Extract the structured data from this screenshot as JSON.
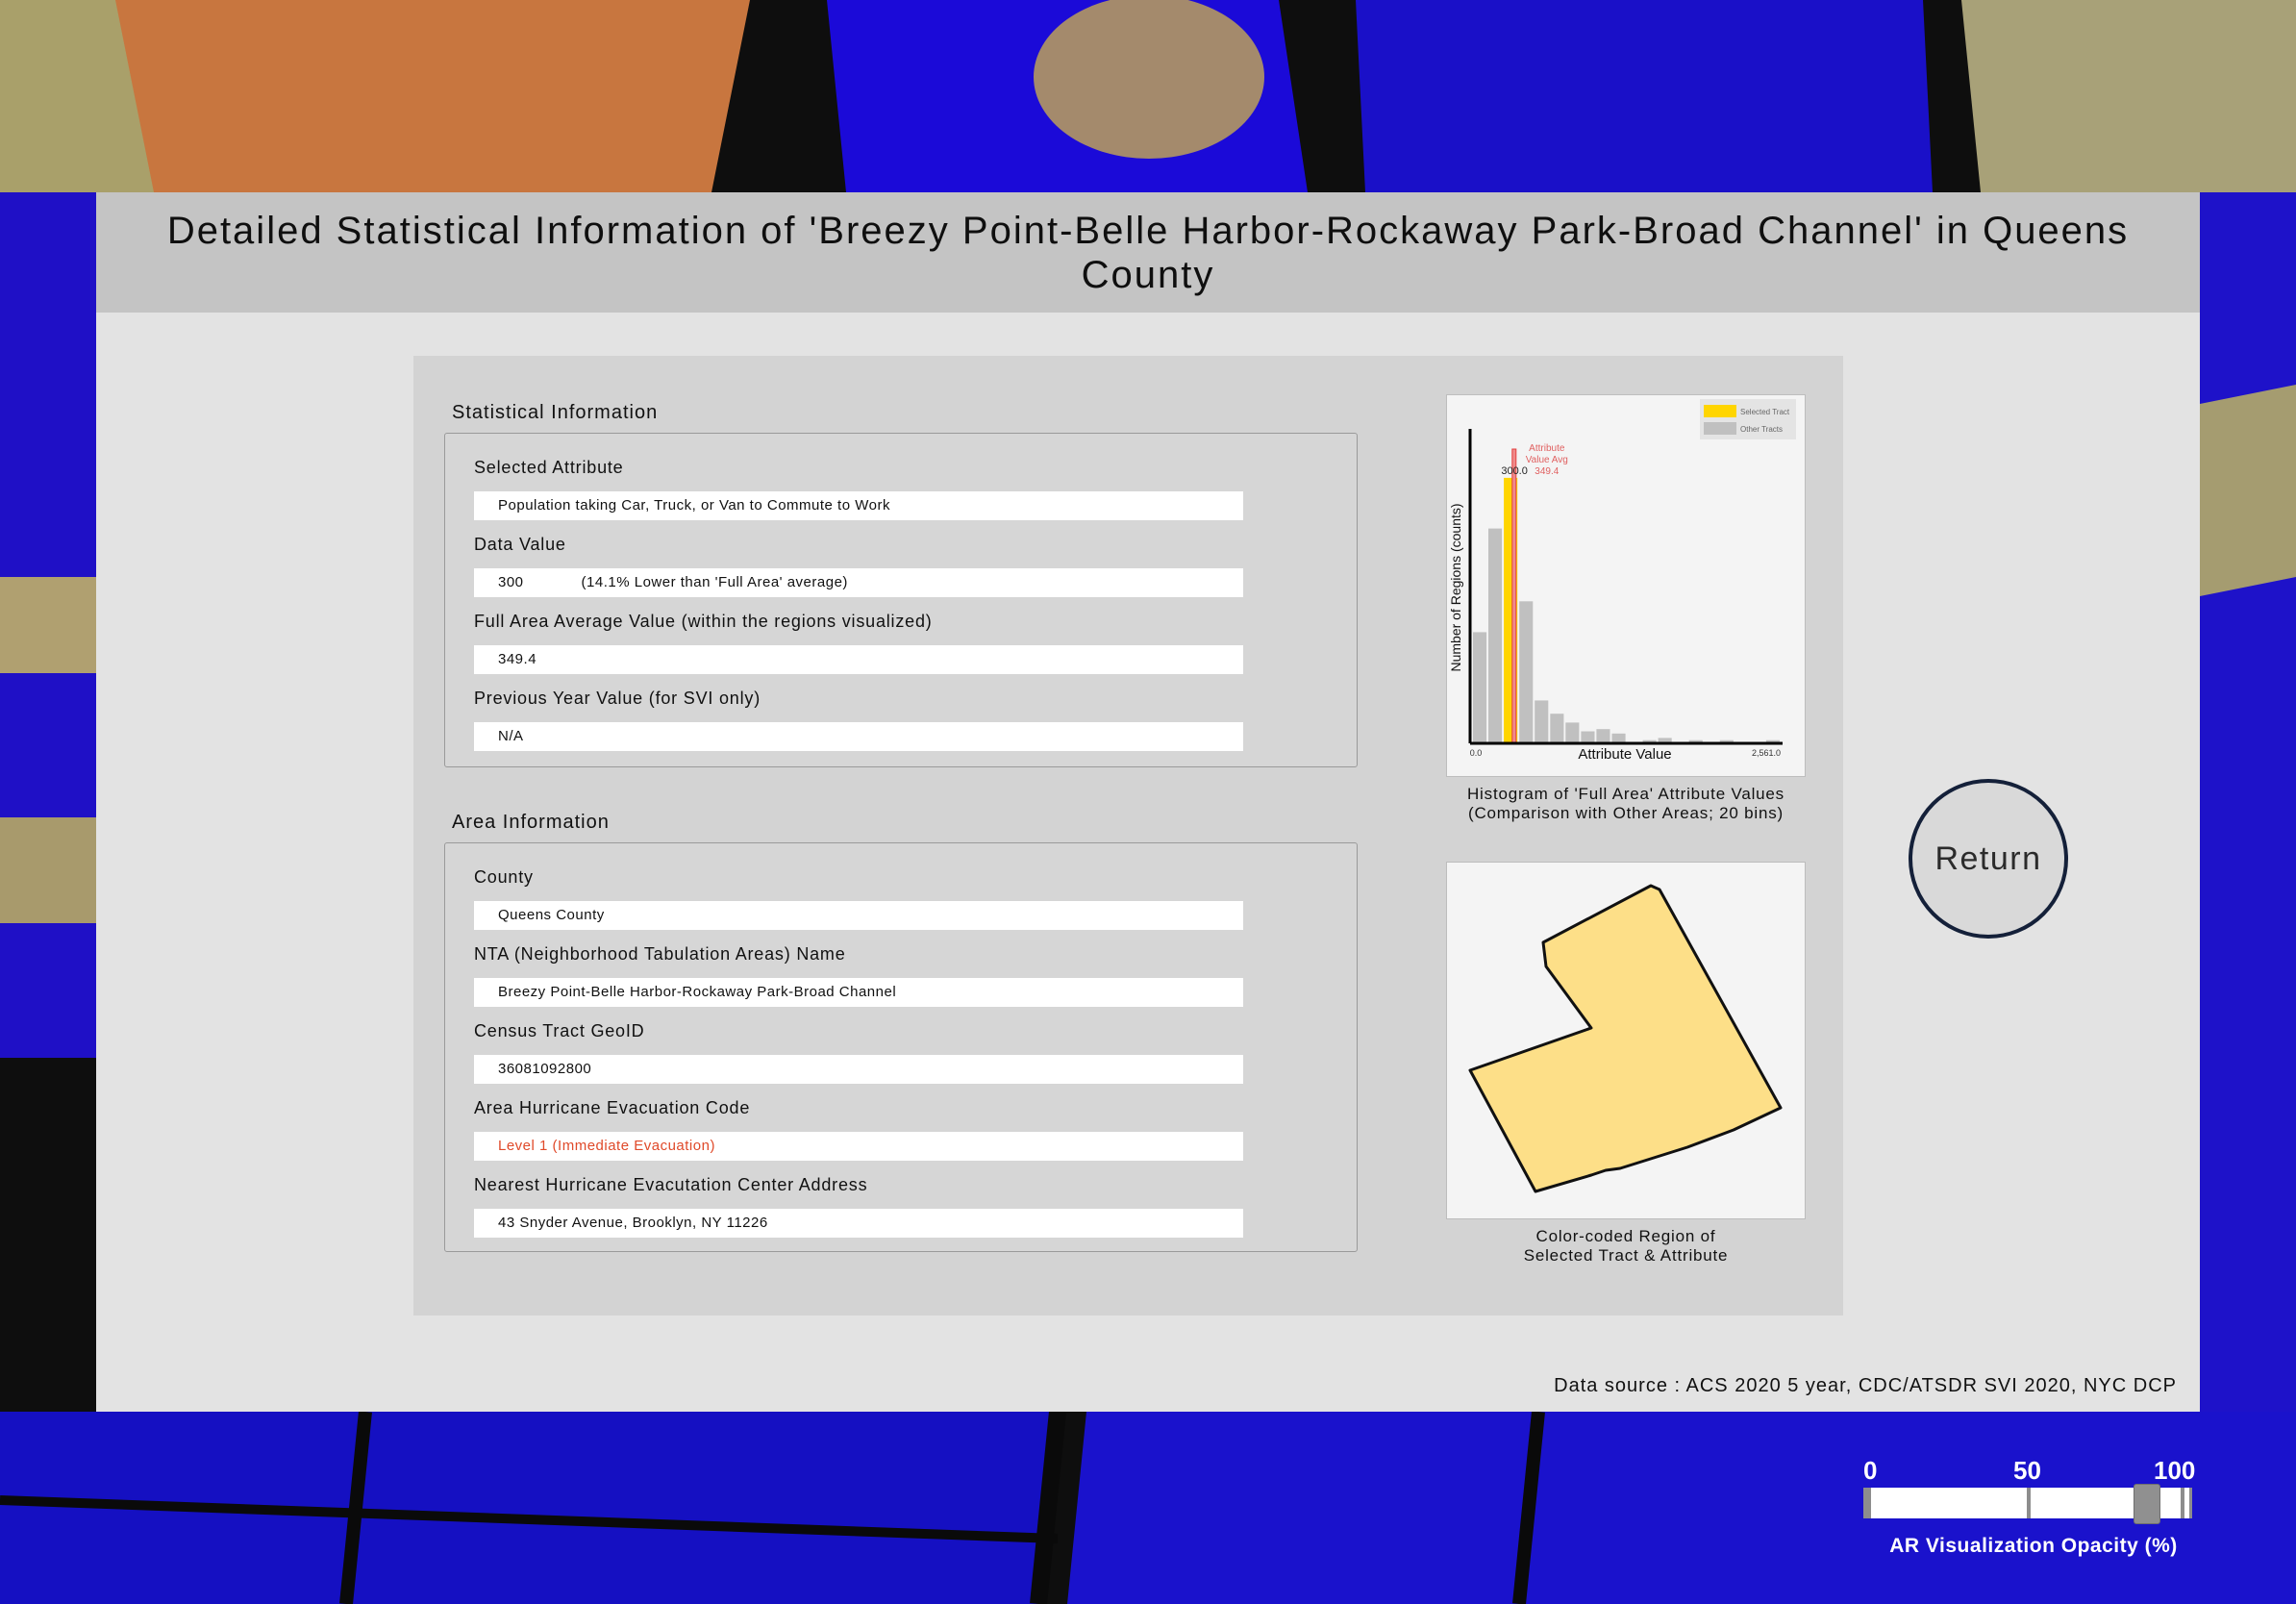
{
  "title": "Detailed Statistical Information of 'Breezy Point-Belle Harbor-Rockaway Park-Broad Channel' in Queens County",
  "statistical": {
    "heading": "Statistical Information",
    "selected_attribute_label": "Selected Attribute",
    "selected_attribute_value": "Population taking Car, Truck, or Van to Commute to Work",
    "data_value_label": "Data Value",
    "data_value": "300",
    "data_value_note": "(14.1% Lower than 'Full Area' average)",
    "full_area_avg_label": "Full Area Average Value (within the regions visualized)",
    "full_area_avg_value": "349.4",
    "prev_year_label": "Previous Year Value (for SVI only)",
    "prev_year_value": "N/A"
  },
  "area": {
    "heading": "Area Information",
    "county_label": "County",
    "county_value": "Queens County",
    "nta_label": "NTA (Neighborhood Tabulation Areas) Name",
    "nta_value": "Breezy Point-Belle Harbor-Rockaway Park-Broad Channel",
    "geoid_label": "Census Tract GeoID",
    "geoid_value": "36081092800",
    "evac_code_label": "Area Hurricane Evacuation Code",
    "evac_code_value": "Level 1 (Immediate Evacuation)",
    "evac_center_label": "Nearest Hurricane Evacutation Center Address",
    "evac_center_value": "43 Snyder Avenue, Brooklyn, NY 11226"
  },
  "histogram": {
    "caption_line1": "Histogram of 'Full Area' Attribute Values",
    "caption_line2": "(Comparison with Other Areas; 20 bins)"
  },
  "region_map": {
    "caption_line1": "Color-coded Region of",
    "caption_line2": "Selected Tract & Attribute",
    "fill_color": "#fddf88"
  },
  "chart_data": {
    "type": "bar",
    "xlabel": "Attribute Value",
    "ylabel": "Number of Regions (counts)",
    "xlim": [
      0,
      2561
    ],
    "x_tick_labels": [
      "0.0",
      "2,561.0"
    ],
    "bins": 20,
    "series": [
      {
        "name": "Selected Tract",
        "color": "#ffd500"
      },
      {
        "name": "Other Tracts",
        "color": "#c0c0c0"
      }
    ],
    "bin_counts": [
      50,
      97,
      120,
      64,
      19,
      13,
      9,
      5,
      6,
      4,
      0,
      1,
      2,
      0,
      1,
      0,
      1,
      0,
      0,
      1
    ],
    "selected_bin_index": 2,
    "selected_value": 300,
    "selected_value_label": "300.0",
    "average_value": 349.4,
    "average_annotation": [
      "Attribute",
      "Value Avg",
      "349.4"
    ],
    "ylim": [
      0,
      140
    ],
    "legend_position": "top-right"
  },
  "return_button": "Return",
  "data_source": "Data source : ACS 2020 5 year, CDC/ATSDR SVI 2020, NYC DCP",
  "opacity_slider": {
    "title": "AR Visualization Opacity (%)",
    "ticks": [
      "0",
      "50",
      "100"
    ],
    "value": 90
  }
}
